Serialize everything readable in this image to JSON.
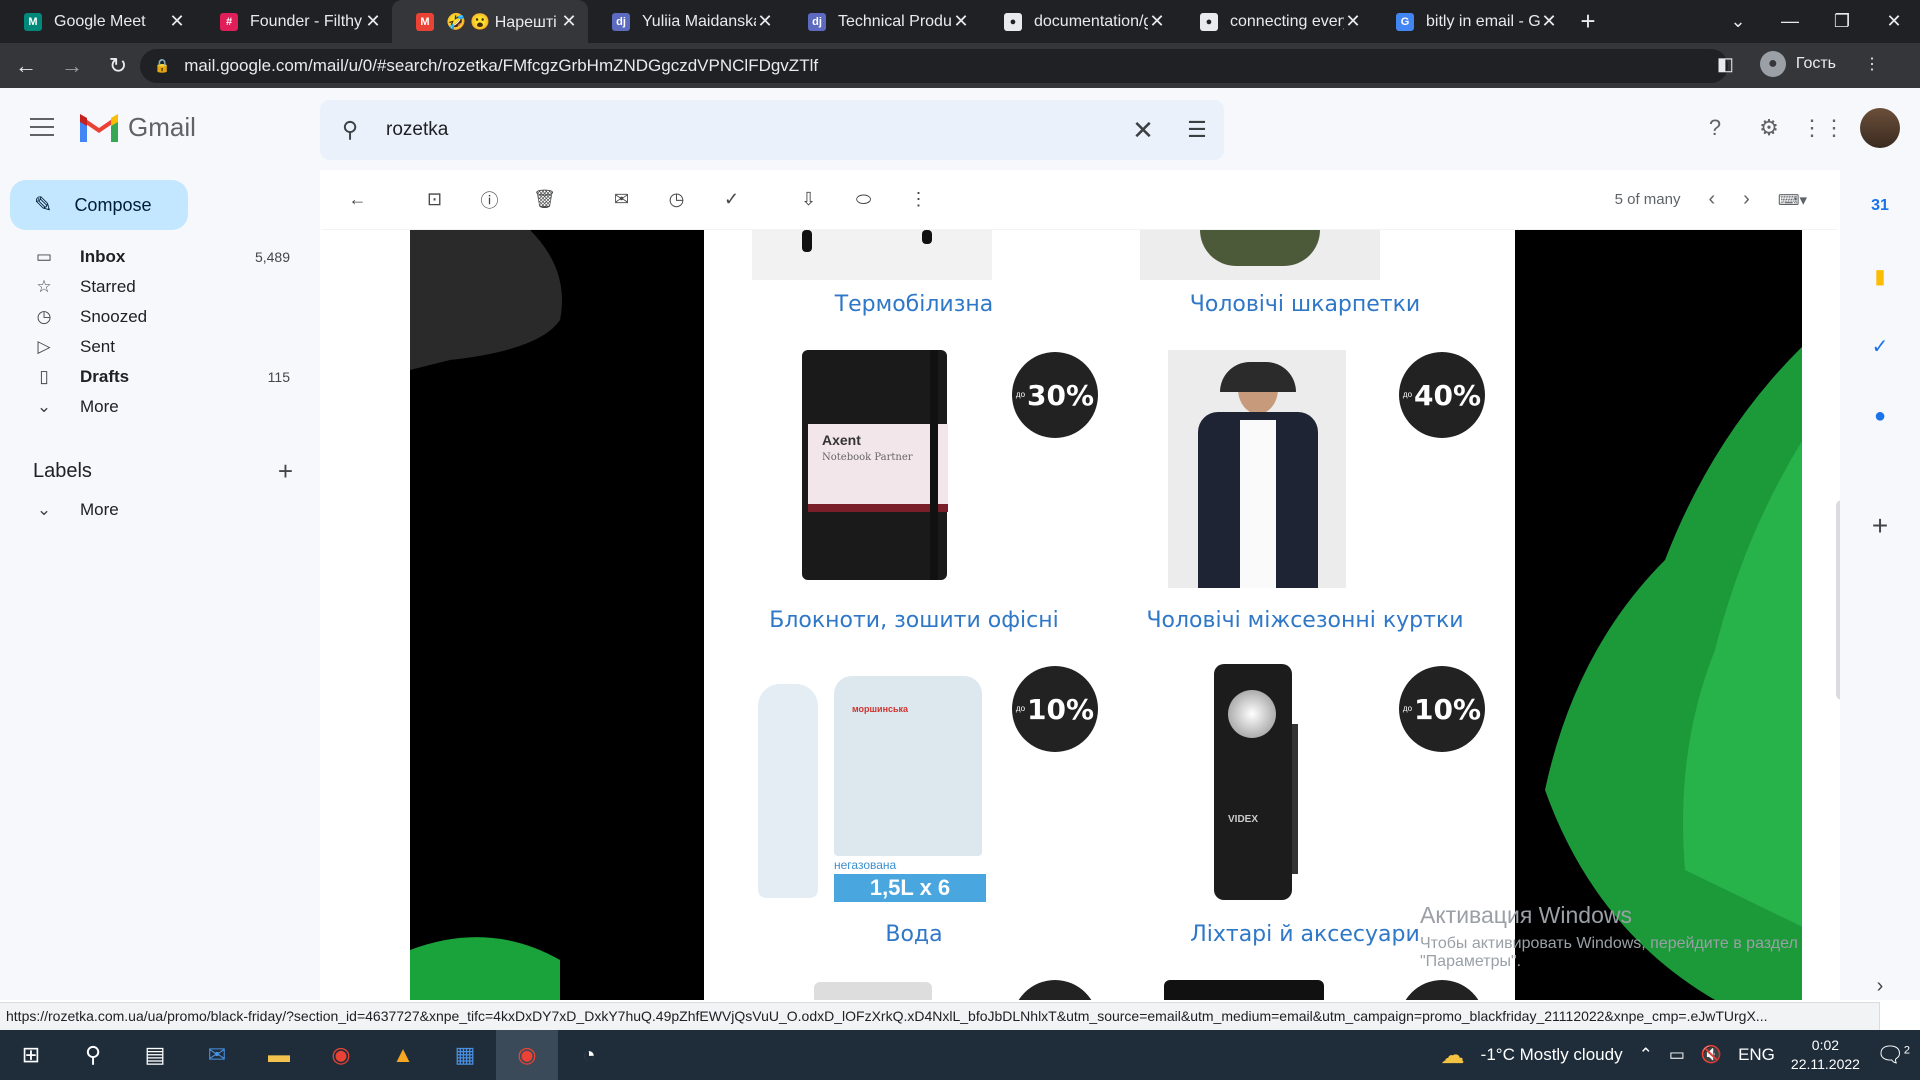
{
  "browser": {
    "tabs": [
      {
        "title": "Google Meet",
        "color": "#00897b",
        "glyph": "M"
      },
      {
        "title": "Founder - Filthy p",
        "color": "#e01e5a",
        "glyph": "#"
      },
      {
        "title": "🤣 😮 Нарешті Ч",
        "color": "#ea4335",
        "glyph": "M",
        "active": true
      },
      {
        "title": "Yuliia Maidanska",
        "color": "#5c6bc0",
        "glyph": "dj"
      },
      {
        "title": "Technical Product",
        "color": "#5c6bc0",
        "glyph": "dj"
      },
      {
        "title": "documentation/g",
        "color": "#e8eaed",
        "glyph": "●"
      },
      {
        "title": "connecting every",
        "color": "#e8eaed",
        "glyph": "●"
      },
      {
        "title": "bitly in email - Go",
        "color": "#4285f4",
        "glyph": "G"
      }
    ],
    "url": "mail.google.com/mail/u/0/#search/rozetka/FMfcgzGrbHmZNDGgczdVPNClFDgvZTlf",
    "profile_label": "Гость"
  },
  "gmail": {
    "app_name": "Gmail",
    "search_query": "rozetka",
    "compose_label": "Compose",
    "nav": [
      {
        "label": "Inbox",
        "count": "5,489",
        "icon": "inbox-icon",
        "glyph": "▭",
        "bold": true
      },
      {
        "label": "Starred",
        "count": "",
        "icon": "star-icon",
        "glyph": "☆"
      },
      {
        "label": "Snoozed",
        "count": "",
        "icon": "clock-icon",
        "glyph": "◷"
      },
      {
        "label": "Sent",
        "count": "",
        "icon": "send-icon",
        "glyph": "▷"
      },
      {
        "label": "Drafts",
        "count": "115",
        "icon": "draft-icon",
        "glyph": "▯",
        "bold": true
      },
      {
        "label": "More",
        "count": "",
        "icon": "chevron-down-icon",
        "glyph": "⌄"
      }
    ],
    "labels_title": "Labels",
    "labels_more": "More",
    "pagination": "5 of many"
  },
  "email": {
    "products": [
      {
        "caption": "Термобілизна",
        "discount": ""
      },
      {
        "caption": "Чоловічі шкарпетки",
        "discount": ""
      },
      {
        "caption": "Блокноти, зошити офісні",
        "discount": "30%",
        "pre": "до"
      },
      {
        "caption": "Чоловічі міжсезонні куртки",
        "discount": "40%",
        "pre": "до"
      },
      {
        "caption": "Вода",
        "discount": "10%",
        "pre": "до"
      },
      {
        "caption": "Ліхтарі й аксесуари",
        "discount": "10%",
        "pre": "до"
      }
    ],
    "notebook_brand": "Axent",
    "notebook_sub": "Notebook Partner",
    "water_tag": "негазована",
    "water_pack": "1,5L x 6",
    "water_brand": "моршинська",
    "flashlight_brand": "VIDEX"
  },
  "watermark": {
    "line1": "Активация Windows",
    "line2": "Чтобы активировать Windows, перейдите в раздел \"Параметры\"."
  },
  "status_url": "https://rozetka.com.ua/ua/promo/black-friday/?section_id=4637727&xnpe_tifc=4kxDxDY7xD_DxkY7huQ.49pZhfEWVjQsVuU_O.odxD_lOFzXrkQ.xD4NxlL_bfoJbDLNhlxT&utm_source=email&utm_medium=email&utm_campaign=promo_blackfriday_21112022&xnpe_cmp=.eJwTUrgX...",
  "taskbar": {
    "weather": "-1°C  Mostly cloudy",
    "lang": "ENG",
    "time": "0:02",
    "date": "22.11.2022",
    "notif_count": "2"
  }
}
